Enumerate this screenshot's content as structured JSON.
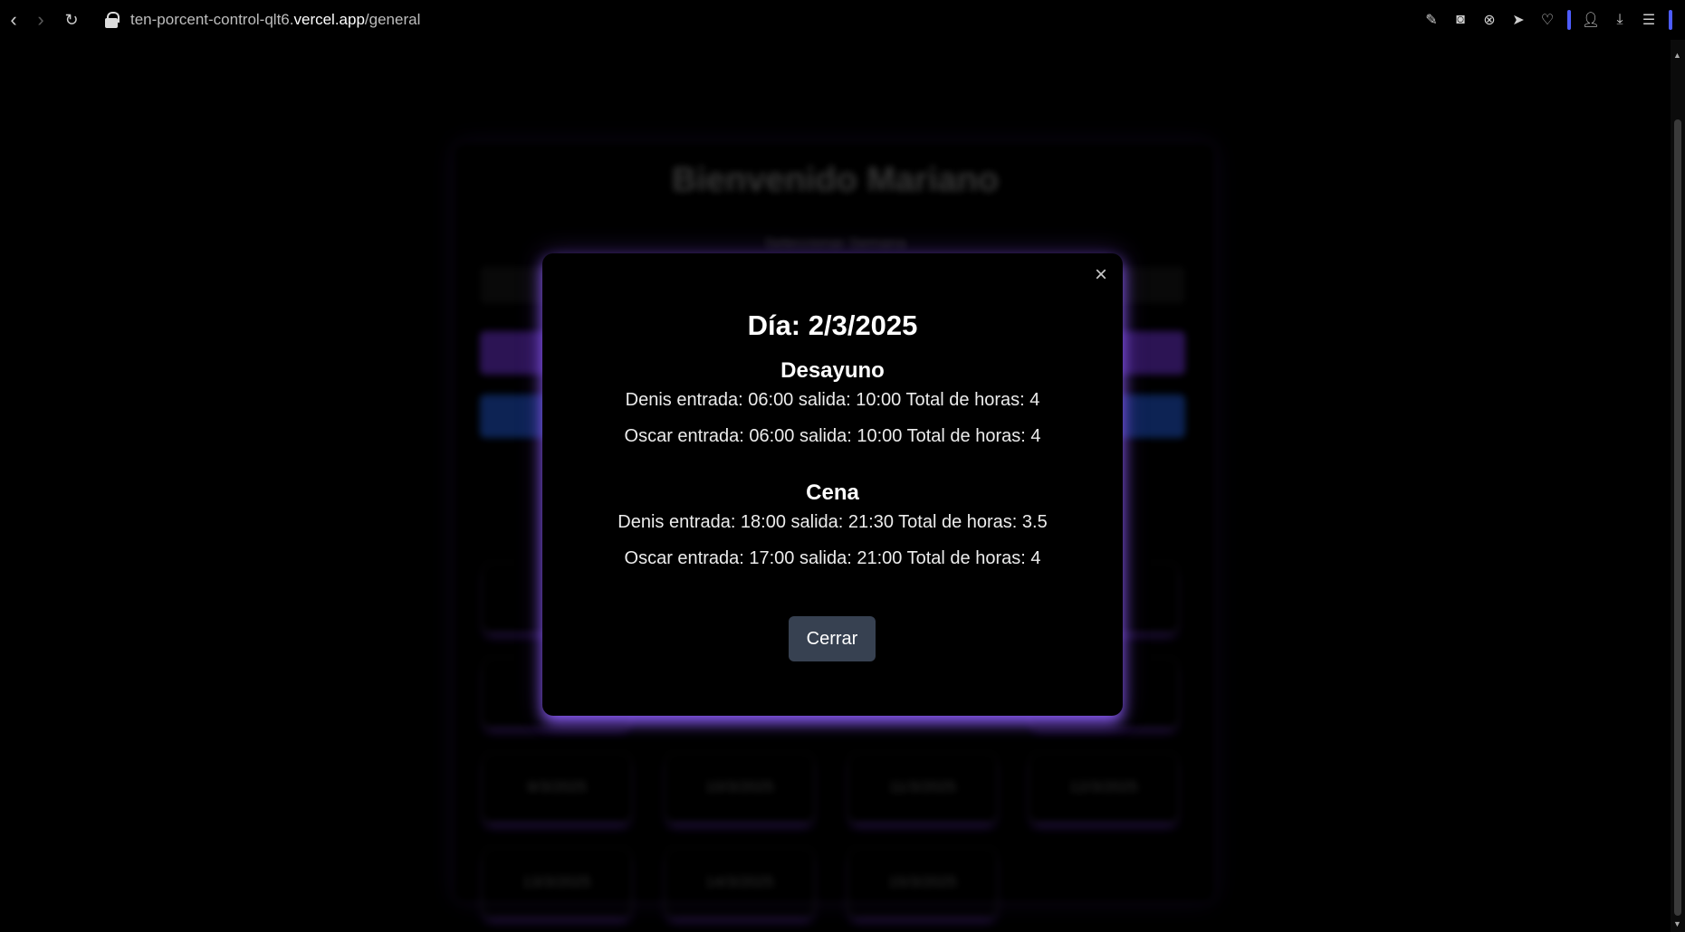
{
  "browser": {
    "url_prefix": "ten-porcent-control-qlt6.",
    "url_domain": "vercel.app",
    "url_path": "/general",
    "accent_color": "#4d5cff"
  },
  "background": {
    "title": "Bienvenido Mariano",
    "subtitle": "Seleccionar Semana",
    "days": [
      "9/3/2025",
      "10/3/2025",
      "11/3/2025",
      "12/3/2025",
      "13/3/2025",
      "14/3/2025",
      "15/3/2025"
    ]
  },
  "modal": {
    "close_symbol": "×",
    "title": "Día: 2/3/2025",
    "sections": [
      {
        "name": "Desayuno",
        "lines": [
          "Denis entrada: 06:00 salida: 10:00 Total de horas: 4",
          "Oscar entrada: 06:00 salida: 10:00 Total de horas: 4"
        ]
      },
      {
        "name": "Cena",
        "lines": [
          "Denis entrada: 18:00 salida: 21:30 Total de horas: 3.5",
          "Oscar entrada: 17:00 salida: 21:00 Total de horas: 4"
        ]
      }
    ],
    "close_button": "Cerrar"
  },
  "colors": {
    "modal_glow": "#8a5cf6",
    "button_bg": "#374151",
    "purple": "#7c3aed",
    "blue": "#2563eb"
  }
}
